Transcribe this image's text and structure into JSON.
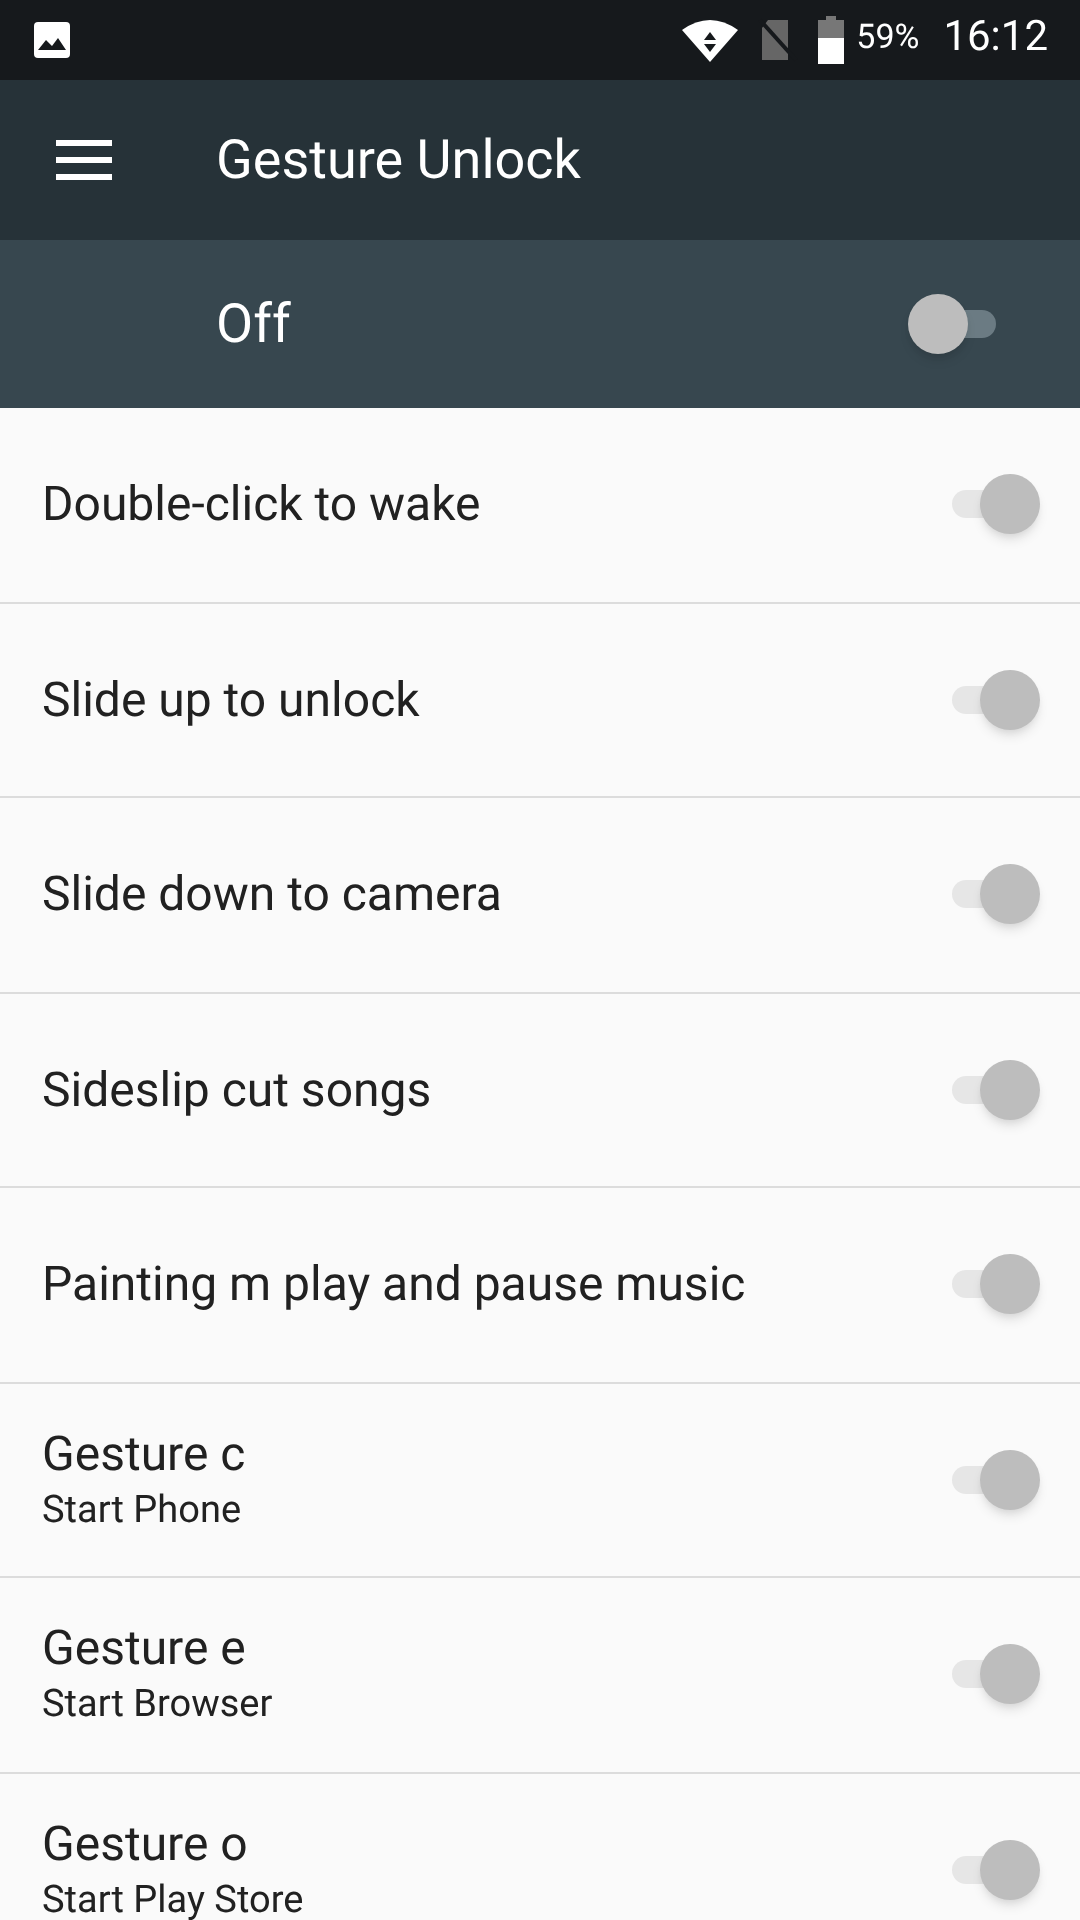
{
  "status_bar": {
    "battery": "59%",
    "time": "16:12"
  },
  "app_bar": {
    "title": "Gesture Unlock"
  },
  "master": {
    "label": "Off",
    "on": false
  },
  "items": [
    {
      "title": "Double-click to wake",
      "on": true,
      "disabled": true
    },
    {
      "title": "Slide up to unlock",
      "on": true,
      "disabled": true
    },
    {
      "title": "Slide down to camera",
      "on": true,
      "disabled": true
    },
    {
      "title": "Sideslip cut songs",
      "on": true,
      "disabled": true
    },
    {
      "title": "Painting m play and pause music",
      "on": true,
      "disabled": true
    },
    {
      "title": "Gesture c",
      "subtitle": "Start Phone",
      "on": true,
      "disabled": true
    },
    {
      "title": "Gesture e",
      "subtitle": "Start Browser",
      "on": true,
      "disabled": true
    },
    {
      "title": "Gesture o",
      "subtitle": "Start Play Store",
      "on": true,
      "disabled": true
    }
  ]
}
